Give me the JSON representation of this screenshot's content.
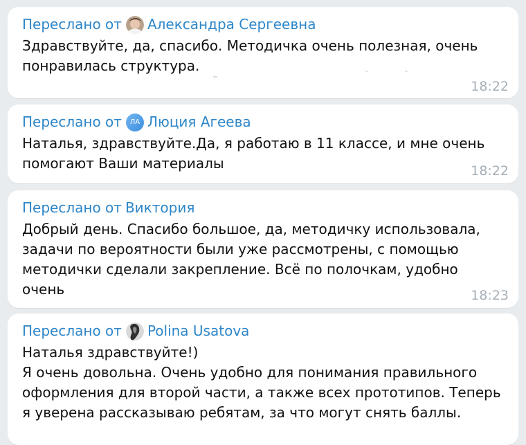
{
  "chat": {
    "messages": [
      {
        "forwarded_label": "Переслано от",
        "sender": "Александра Сергеевна",
        "avatar_type": "photo",
        "text": "Здравствуйте, да, спасибо. Методичка очень полезная, очень\nпонравилась структура.",
        "time": "18:22"
      },
      {
        "forwarded_label": "Переслано от",
        "sender": "Люция Агеева",
        "avatar_type": "initials",
        "avatar_initials": "ЛА",
        "text": "Наталья, здравствуйте.Да, я работаю в 11 классе, и мне очень\nпомогают Ваши материалы",
        "time": "18:22"
      },
      {
        "forwarded_label": "Переслано от",
        "sender": "Виктория",
        "avatar_type": "none",
        "text": "Добрый день. Спасибо большое, да, методичку использовала,\nзадачи по вероятности были уже рассмотрены, с помощью\nметодички сделали закрепление. Всё по полочкам, удобно\nочень",
        "time": "18:23"
      },
      {
        "forwarded_label": "Переслано от",
        "sender": "Polina Usatova",
        "avatar_type": "photo",
        "text": "Наталья здравствуйте!)\nЯ очень довольна. Очень удобно для понимания правильного\nоформления для второй части, а также всех прототипов. Теперь\nя уверена рассказываю ребятам, за что могут снять баллы."
      }
    ]
  },
  "colors": {
    "background": "#e8ecef",
    "bubble": "#ffffff",
    "forward_accent": "#2d86c9",
    "text": "#111111",
    "time": "#a7b0b8"
  },
  "icons": {
    "avatar_photo": "person-photo-icon",
    "avatar_initials": "initials-avatar-icon"
  }
}
